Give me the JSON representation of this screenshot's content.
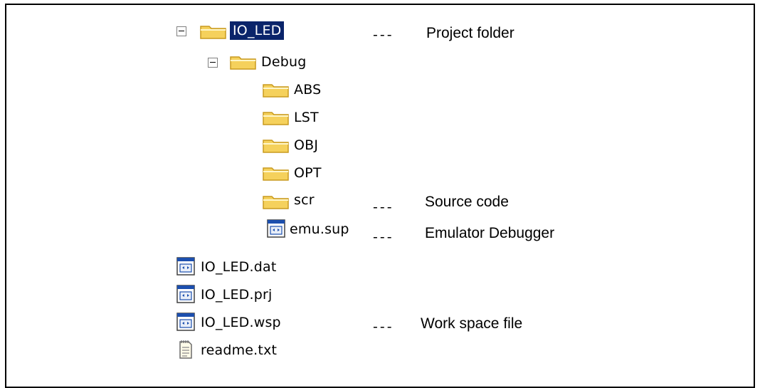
{
  "tree": {
    "root": {
      "label": "IO_LED",
      "icon": "folder-icon",
      "expanded": true,
      "selected": true,
      "note": "Project folder"
    },
    "debug": {
      "label": "Debug",
      "icon": "folder-icon",
      "expanded": true
    },
    "debug_children": [
      {
        "label": "ABS",
        "icon": "folder-icon"
      },
      {
        "label": "LST",
        "icon": "folder-icon"
      },
      {
        "label": "OBJ",
        "icon": "folder-icon"
      },
      {
        "label": "OPT",
        "icon": "folder-icon"
      },
      {
        "label": "scr",
        "icon": "folder-icon",
        "note": "Source code"
      },
      {
        "label": "emu.sup",
        "icon": "file-icon",
        "note": "Emulator Debugger"
      }
    ],
    "root_files": [
      {
        "label": "IO_LED.dat",
        "icon": "file-icon"
      },
      {
        "label": "IO_LED.prj",
        "icon": "file-icon"
      },
      {
        "label": "IO_LED.wsp",
        "icon": "file-icon",
        "note": "Work space file"
      },
      {
        "label": "readme.txt",
        "icon": "text-file-icon"
      }
    ]
  },
  "separator": "---",
  "colors": {
    "selection": "#0a246a",
    "folder": "#f5d15c",
    "folder_dark": "#c99a1e"
  }
}
